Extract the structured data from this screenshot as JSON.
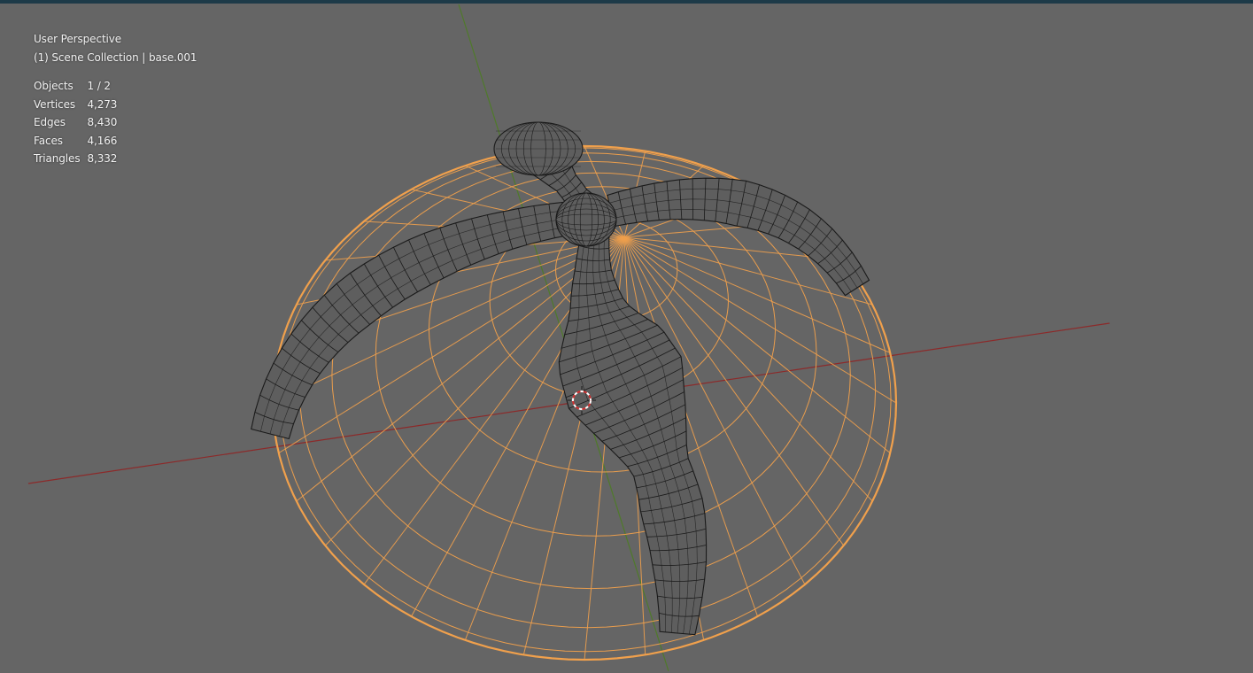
{
  "viewport": {
    "view_name": "User Perspective",
    "scene_info": "(1) Scene Collection | base.001"
  },
  "stats": [
    {
      "label": "Objects",
      "value": "1 / 2"
    },
    {
      "label": "Vertices",
      "value": "4,273"
    },
    {
      "label": "Edges",
      "value": "8,430"
    },
    {
      "label": "Faces",
      "value": "4,166"
    },
    {
      "label": "Triangles",
      "value": "8,332"
    }
  ],
  "colors": {
    "background": "#656565",
    "selected_outline": "#f0a04c",
    "wire": "#1a1a1a",
    "x_axis": "#8c2a2a",
    "y_axis": "#4f7a2a"
  }
}
